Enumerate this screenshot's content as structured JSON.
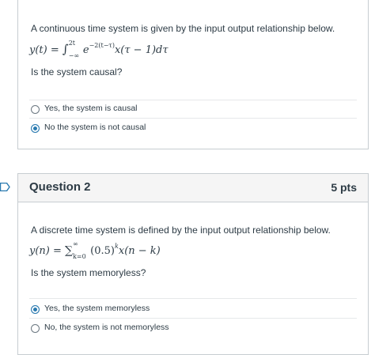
{
  "question1": {
    "prompt": "A continuous time system is given by the input output relationship below.",
    "equation": {
      "lhs": "y(t) =",
      "integral": "∫",
      "upper": "2t",
      "lower": "−∞",
      "body_base": "e",
      "body_exp": "−2(t−τ)",
      "body_rest": "x(τ − 1)dτ"
    },
    "question": "Is the system causal?",
    "answers": [
      {
        "label": "Yes, the system is causal",
        "selected": false
      },
      {
        "label": "No the system is not causal",
        "selected": true
      }
    ]
  },
  "question2": {
    "title": "Question 2",
    "points": "5 pts",
    "prompt": "A discrete time system is defined by the input output relationship below.",
    "equation": {
      "lhs": "y(n) =",
      "sum": "∑",
      "upper": "∞",
      "lower": "k=0",
      "body_base": "(0.5)",
      "body_exp": "k",
      "body_rest": "x(n − k)"
    },
    "question": "Is the system memoryless?",
    "answers": [
      {
        "label": "Yes, the system memoryless",
        "selected": true
      },
      {
        "label": "No, the system is not memoryless",
        "selected": false
      }
    ]
  },
  "colors": {
    "accent": "#2a7ab0",
    "border": "#c7cdd1",
    "header_bg": "#f5f5f5",
    "text": "#2d3b45"
  },
  "icons": {
    "flag": "bookmark-flag-icon",
    "radio": "radio-icon"
  }
}
